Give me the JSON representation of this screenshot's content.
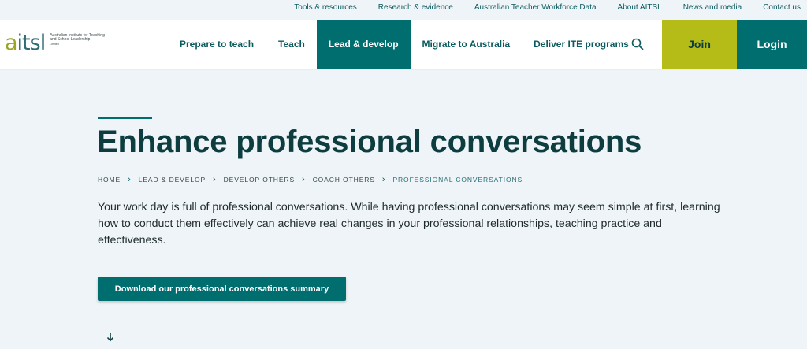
{
  "utility_nav": {
    "items": [
      "Tools & resources",
      "Research & evidence",
      "Australian Teacher Workforce Data",
      "About AITSL",
      "News and media",
      "Contact us"
    ]
  },
  "logo": {
    "mark_a": "a",
    "mark_rest": "itsl",
    "tagline": "Australian Institute for Teaching and School Leadership",
    "tagline_small": "Limited"
  },
  "main_nav": {
    "items": [
      {
        "label": "Prepare to teach"
      },
      {
        "label": "Teach"
      },
      {
        "label": "Lead & develop"
      },
      {
        "label": "Migrate to Australia"
      },
      {
        "label": "Deliver ITE programs"
      }
    ],
    "active_index": 2,
    "search_icon": "search-icon",
    "join_label": "Join",
    "login_label": "Login"
  },
  "page": {
    "title": "Enhance professional conversations",
    "breadcrumb": [
      "HOME",
      "LEAD & DEVELOP",
      "DEVELOP OTHERS",
      "COACH OTHERS",
      "PROFESSIONAL CONVERSATIONS"
    ],
    "intro": "Your work day is full of professional conversations. While having professional conversations may seem simple at first, learning how to conduct them effectively can achieve real changes in your professional relationships, teaching practice and effectiveness.",
    "download_label": "Download our professional conversations summary",
    "scroll_icon": "arrow-down-icon"
  },
  "colors": {
    "brand_teal": "#006d6f",
    "brand_lime": "#b5bc18",
    "heading": "#0d3d3f",
    "page_bg": "#eef4f7"
  }
}
